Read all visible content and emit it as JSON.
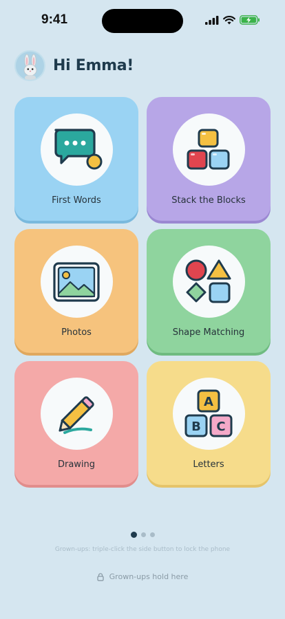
{
  "status_bar": {
    "time": "9:41"
  },
  "header": {
    "greeting": "Hi Emma!",
    "avatar_icon": "bunny-icon"
  },
  "cards": [
    {
      "label": "First Words",
      "icon": "chat-bubble-icon",
      "color": "#9ad3f3"
    },
    {
      "label": "Stack the Blocks",
      "icon": "blocks-icon",
      "color": "#b7a6e7"
    },
    {
      "label": "Photos",
      "icon": "picture-icon",
      "color": "#f6c37d"
    },
    {
      "label": "Shape Matching",
      "icon": "shapes-icon",
      "color": "#8fd49e"
    },
    {
      "label": "Drawing",
      "icon": "pencil-icon",
      "color": "#f4a9a8"
    },
    {
      "label": "Letters",
      "icon": "abc-blocks-icon",
      "color": "#f6dc8b"
    }
  ],
  "pager": {
    "pages": 3,
    "current": 1
  },
  "footer": {
    "hint": "Grown-ups: triple-click the side button to lock the phone",
    "hold_label": "Grown-ups hold here"
  }
}
